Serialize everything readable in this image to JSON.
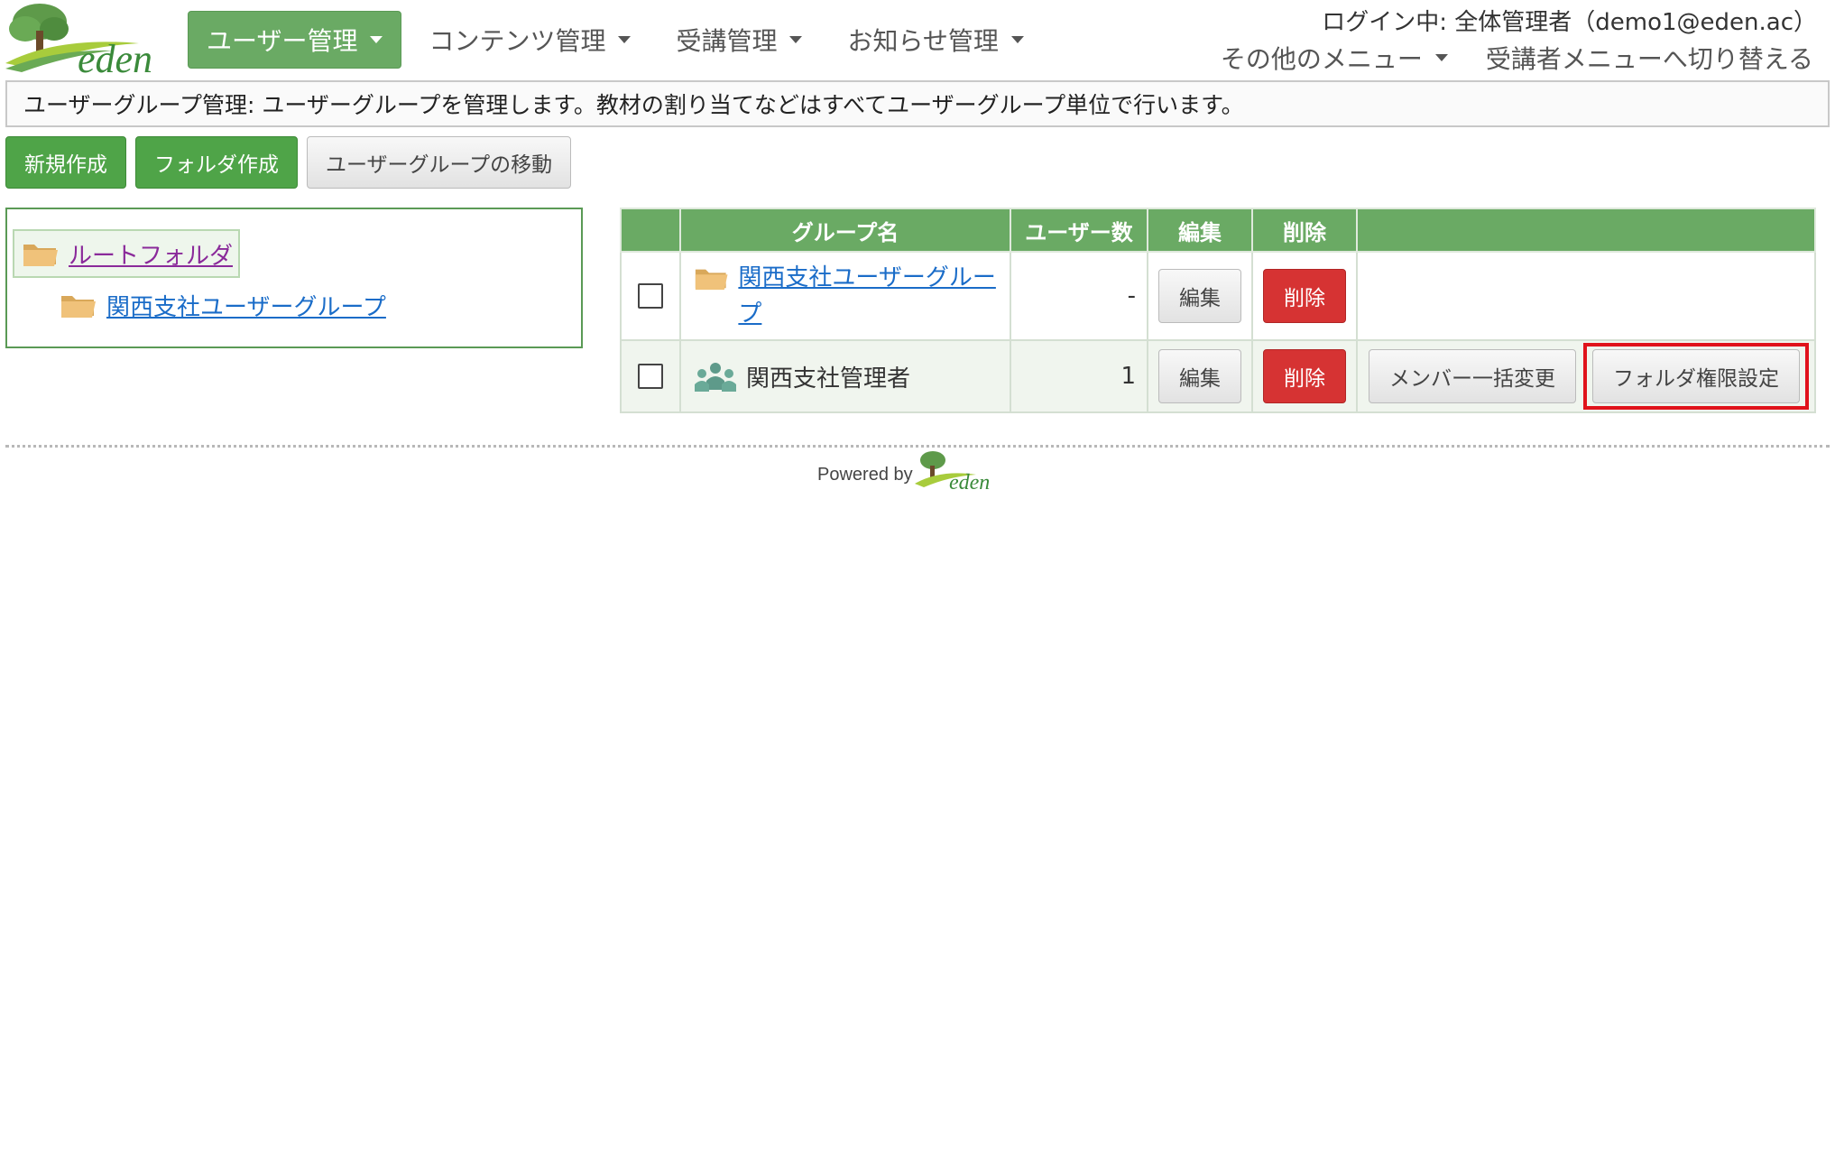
{
  "brand": {
    "name": "eden",
    "accent": "#6aaa64",
    "danger": "#d63333"
  },
  "nav": {
    "items": [
      {
        "label": "ユーザー管理",
        "active": true
      },
      {
        "label": "コンテンツ管理",
        "active": false
      },
      {
        "label": "受講管理",
        "active": false
      },
      {
        "label": "お知らせ管理",
        "active": false
      }
    ]
  },
  "header": {
    "login_info": "ログイン中: 全体管理者（demo1@eden.ac）",
    "other_menu": "その他のメニュー",
    "switch_menu": "受講者メニューへ切り替える"
  },
  "description": "ユーザーグループ管理: ユーザーグループを管理します。教材の割り当てなどはすべてユーザーグループ単位で行います。",
  "actions": {
    "new": "新規作成",
    "new_folder": "フォルダ作成",
    "move": "ユーザーグループの移動"
  },
  "tree": {
    "root": "ルートフォルダ",
    "child": "関西支社ユーザーグループ"
  },
  "table": {
    "headers": {
      "checkbox": "",
      "group_name": "グループ名",
      "user_count": "ユーザー数",
      "edit": "編集",
      "delete": "削除",
      "extra": ""
    },
    "rows": [
      {
        "type": "folder",
        "name": "関西支社ユーザーグループ",
        "count": "-",
        "edit": "編集",
        "delete": "削除"
      },
      {
        "type": "group",
        "name": "関西支社管理者",
        "count": "1",
        "edit": "編集",
        "delete": "削除",
        "bulk_change": "メンバー一括変更",
        "folder_permission": "フォルダ権限設定"
      }
    ]
  },
  "footer": {
    "powered_by": "Powered by"
  }
}
